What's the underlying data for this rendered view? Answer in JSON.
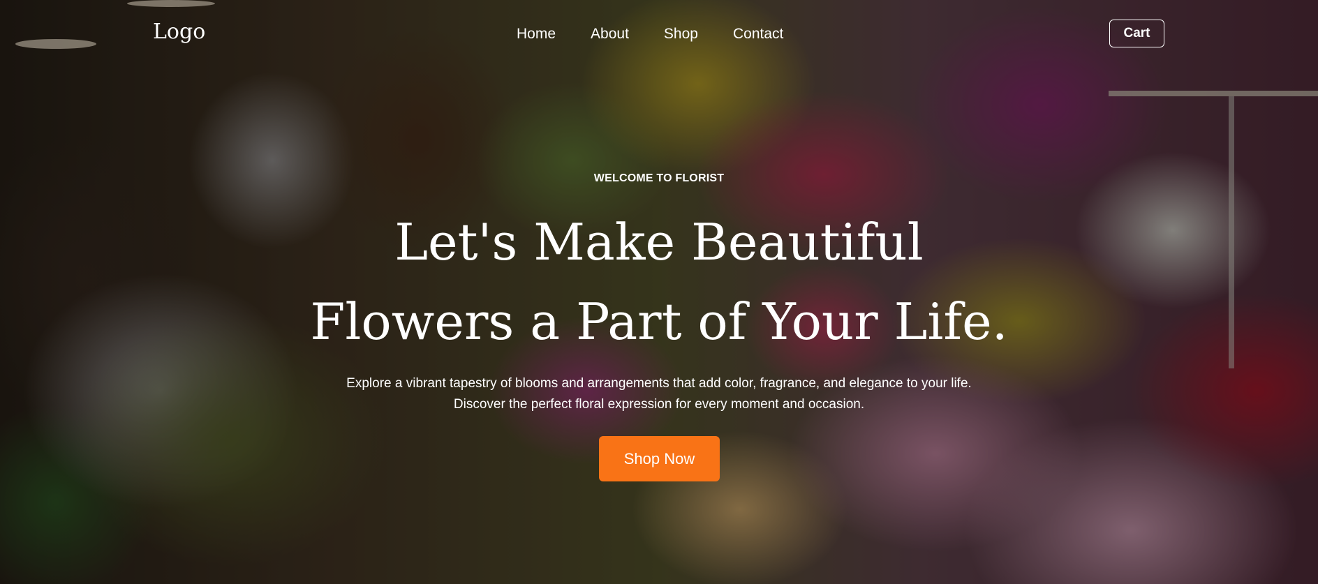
{
  "header": {
    "logo": "Logo",
    "nav": [
      {
        "label": "Home"
      },
      {
        "label": "About"
      },
      {
        "label": "Shop"
      },
      {
        "label": "Contact"
      }
    ],
    "cart_label": "Cart"
  },
  "hero": {
    "eyebrow": "WELCOME TO FLORIST",
    "headline_line1": "Let's Make Beautiful",
    "headline_line2": "Flowers a Part of Your Life.",
    "description_line1": "Explore a vibrant tapestry of blooms and arrangements that add color, fragrance, and elegance to your life.",
    "description_line2": "Discover the perfect floral expression for every moment and occasion.",
    "cta_label": "Shop Now"
  },
  "colors": {
    "accent": "#f97316",
    "text": "#ffffff",
    "overlay": "rgba(0,0,0,0.42)"
  }
}
